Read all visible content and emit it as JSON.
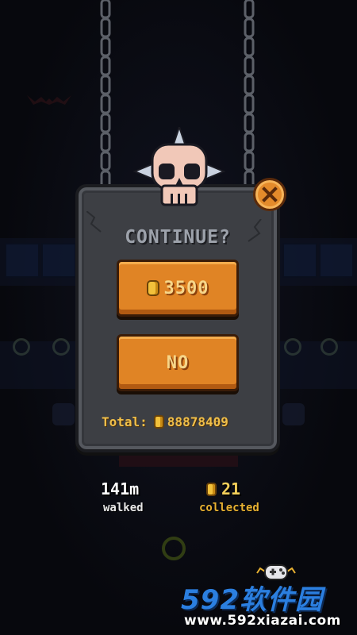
{
  "dialog": {
    "title": "CONTINUE?",
    "buy_button": {
      "cost": "3500",
      "icon": "coin-icon"
    },
    "no_button": {
      "label": "NO"
    },
    "total": {
      "label": "Total:",
      "value": "88878409",
      "icon": "coin-icon"
    },
    "close_icon": "close-x-icon"
  },
  "stats": {
    "distance": {
      "value": "141m",
      "label": "walked"
    },
    "coins": {
      "value": "21",
      "label": "collected",
      "icon": "coin-icon"
    }
  },
  "watermark": {
    "logo": "592软件园",
    "url": "www.592xiazai.com"
  },
  "colors": {
    "button_orange": "#e08425",
    "coin_gold": "#f2c13b",
    "panel_gray": "#3d3f44",
    "title_gray": "#9da2ab",
    "watermark_blue": "#2b7fe0"
  }
}
